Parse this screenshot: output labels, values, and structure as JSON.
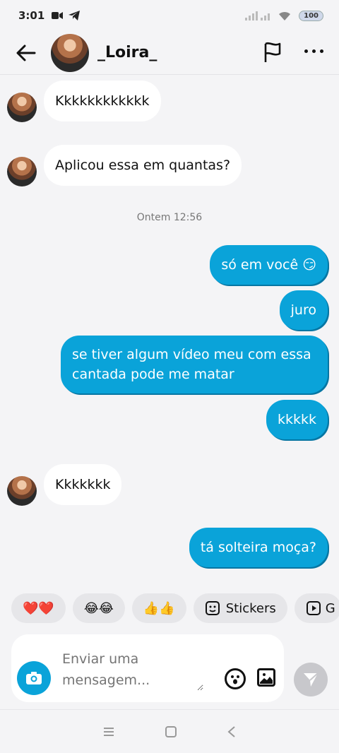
{
  "status": {
    "time": "3:01",
    "battery": "100"
  },
  "header": {
    "name": "_Loira_"
  },
  "messages": {
    "m1": "Kkkkkkkkkkkk",
    "m2": "Aplicou essa em quantas?",
    "timestamp": "Ontem 12:56",
    "m3": "só em você 😏",
    "m4": "juro",
    "m5_line1": "se tiver algum vídeo meu com essa",
    "m5_line2": "cantada pode me matar",
    "m6": "kkkkk",
    "m7": "Kkkkkkk",
    "m8": "tá solteira moça?"
  },
  "reactions": {
    "r1": "❤️❤️",
    "r2": "😂😂",
    "r3": "👍👍",
    "stickers_label": "Stickers",
    "last": "G"
  },
  "composer": {
    "placeholder": "Enviar uma mensagem..."
  }
}
